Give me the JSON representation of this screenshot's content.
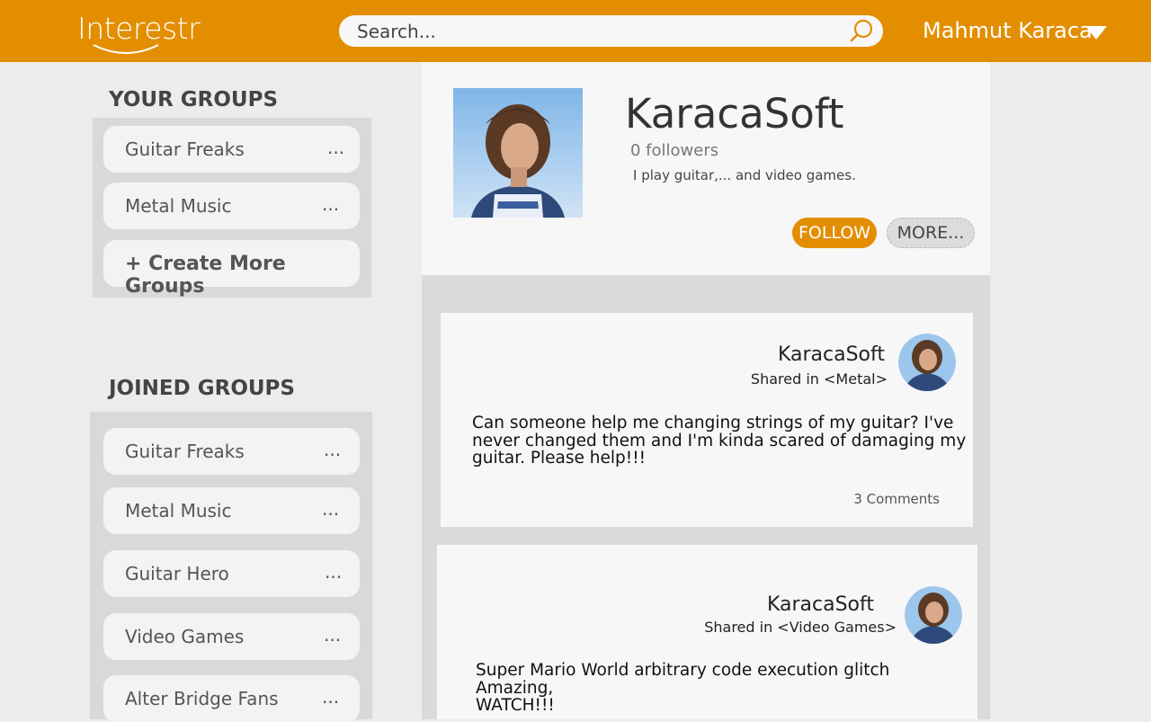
{
  "header": {
    "logo_text": "Interestr",
    "search": {
      "placeholder": "Search...",
      "value": ""
    },
    "user_name": "Mahmut Karaca",
    "colors": {
      "brand": "#e38e00"
    }
  },
  "sidebar": {
    "your_groups_title": "YOUR GROUPS",
    "your_groups": [
      {
        "label": "Guitar Freaks",
        "more": "..."
      },
      {
        "label": "Metal Music",
        "more": "..."
      }
    ],
    "create_label": "+ Create More Groups",
    "joined_groups_title": "JOINED GROUPS",
    "joined_groups": [
      {
        "label": "Guitar Freaks",
        "more": "..."
      },
      {
        "label": "Metal Music",
        "more": "..."
      },
      {
        "label": "Guitar Hero",
        "more": "..."
      },
      {
        "label": "Video Games",
        "more": "..."
      },
      {
        "label": "Alter Bridge Fans",
        "more": "..."
      }
    ]
  },
  "profile": {
    "name": "KaracaSoft",
    "followers": "0 followers",
    "bio": "I play guitar,... and video games.",
    "follow_label": "FOLLOW",
    "more_label": "MORE..."
  },
  "posts": [
    {
      "author": "KaracaSoft",
      "shared_in": "Shared in <Metal>",
      "body_lines": [
        "Can someone help me changing strings of my guitar? I've",
        "never changed them and I'm kinda scared of damaging my",
        "guitar. Please help!!!"
      ],
      "comments": "3 Comments"
    },
    {
      "author": "KaracaSoft",
      "shared_in": "Shared in <Video Games>",
      "body_lines": [
        "Super Mario World arbitrary code execution glitch",
        "Amazing,",
        "WATCH!!!"
      ]
    }
  ]
}
